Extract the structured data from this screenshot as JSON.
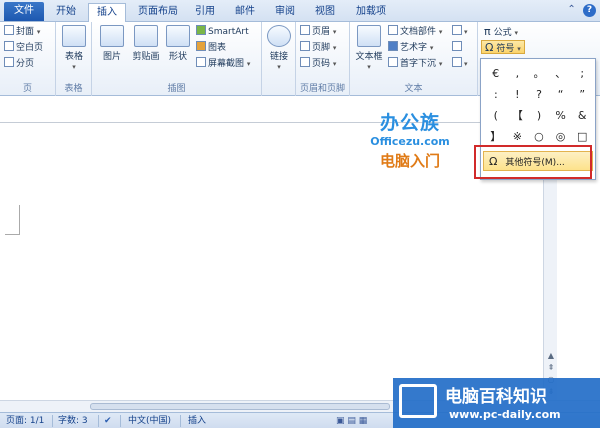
{
  "tabs": [
    "文件",
    "开始",
    "插入",
    "页面布局",
    "引用",
    "邮件",
    "审阅",
    "视图",
    "加载项"
  ],
  "ribbon": {
    "pages": {
      "items": [
        "封面",
        "空白页",
        "分页"
      ],
      "label": "页"
    },
    "table": {
      "button": "表格",
      "label": "表格"
    },
    "illustrations": {
      "picture": "图片",
      "clipart": "剪贴画",
      "shapes": "形状",
      "smartart": "SmartArt",
      "chart": "图表",
      "screenshot": "屏幕截图",
      "label": "插图"
    },
    "links": {
      "button": "链接"
    },
    "header_footer": {
      "items": [
        "页眉",
        "页脚",
        "页码"
      ],
      "label": "页眉和页脚"
    },
    "text": {
      "textbox": "文本框",
      "items": [
        "文档部件",
        "艺术字",
        "首字下沉"
      ],
      "label": "文本"
    },
    "symbols": {
      "equation": "公式",
      "symbol": "符号"
    }
  },
  "dropdown": {
    "symbols": [
      "€",
      ",",
      "。",
      "、",
      ";",
      ":",
      "!",
      "?",
      "“",
      "”",
      "(",
      "【",
      ")",
      "%",
      "&",
      "】",
      "※",
      "○",
      "◎",
      "□"
    ],
    "more_symbols": "其他符号(M)..."
  },
  "status": {
    "page": "页面: 1/1",
    "words": "字数: 3",
    "language": "中文(中国)",
    "mode": "插入"
  },
  "watermark": {
    "brand_cn": "办公族",
    "brand_url": "Officezu.com",
    "brand_sub": "电脑入门",
    "site_cn": "电脑百科知识",
    "site_url": "www.pc-daily.com"
  }
}
